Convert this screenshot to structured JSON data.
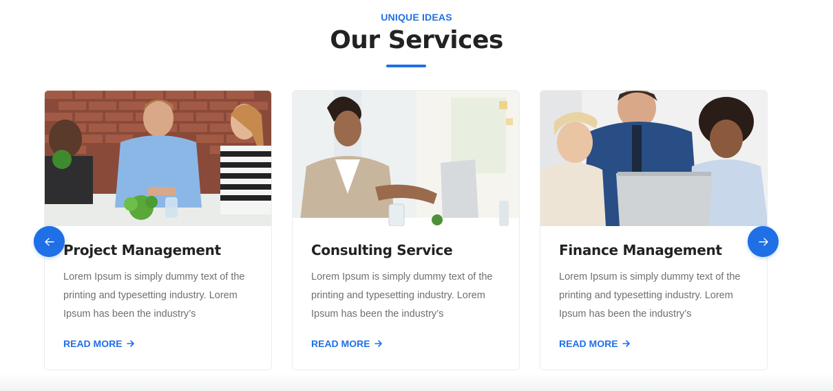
{
  "section": {
    "eyebrow": "UNIQUE IDEAS",
    "title": "Our Services",
    "accent_color": "#1f6fe6"
  },
  "cards": [
    {
      "title": "Project Management",
      "text": "Lorem Ipsum is simply dummy text of the printing and typesetting industry. Lorem Ipsum has been the industry’s",
      "link_label": "READ MORE",
      "image": "team-meeting-photo"
    },
    {
      "title": "Consulting Service",
      "text": "Lorem Ipsum is simply dummy text of the printing and typesetting industry. Lorem Ipsum has been the industry’s",
      "link_label": "READ MORE",
      "image": "woman-with-laptop-photo"
    },
    {
      "title": "Finance Management",
      "text": "Lorem Ipsum is simply dummy text of the printing and typesetting industry. Lorem Ipsum has been the industry’s",
      "link_label": "READ MORE",
      "image": "team-at-laptop-photo"
    }
  ],
  "carousel": {
    "prev_icon": "arrow-left-icon",
    "next_icon": "arrow-right-icon"
  }
}
